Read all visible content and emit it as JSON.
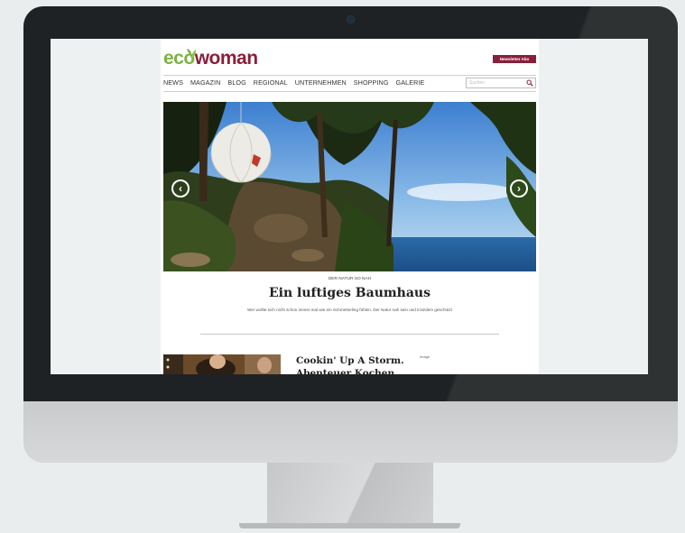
{
  "site": {
    "logo_part1": "eco",
    "logo_part2": "woman",
    "newsletter_label": "Newsletter Abo",
    "search_placeholder": "Suchen",
    "colors": {
      "brand_green": "#7cb342",
      "brand_wine": "#8a1f3c"
    }
  },
  "nav": {
    "items": [
      {
        "label": "NEWS"
      },
      {
        "label": "MAGAZIN"
      },
      {
        "label": "BLOG"
      },
      {
        "label": "REGIONAL"
      },
      {
        "label": "UNTERNEHMEN"
      },
      {
        "label": "SHOPPING"
      },
      {
        "label": "GALERIE"
      }
    ]
  },
  "hero": {
    "kicker": "DER NATUR SO NAH",
    "headline": "Ein luftiges Baumhaus",
    "teaser": "Wer wollte sich nicht schon immer mal wie ein Schmetterling fühlen. Der Natur nah sein und trotzdem geschützt",
    "prev_icon": "‹",
    "next_icon": "›"
  },
  "teaser_card": {
    "title_line1": "Cookin' Up A Storm.",
    "title_line2": "Abenteuer Kochen",
    "tag": "Image"
  }
}
